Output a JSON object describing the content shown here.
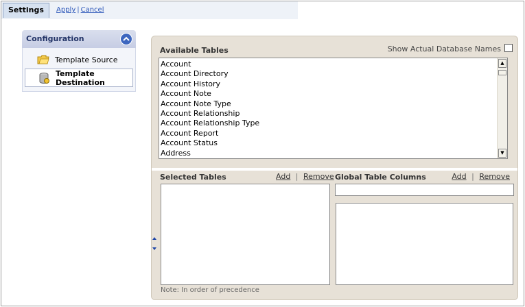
{
  "toolbar": {
    "tab_label": "Settings",
    "apply_label": "Apply",
    "separator": "|",
    "cancel_label": "Cancel"
  },
  "configuration": {
    "title": "Configuration",
    "items": [
      {
        "label": "Template Source",
        "icon": "folder-star-icon",
        "active": false
      },
      {
        "label": "Template Destination",
        "icon": "drive-icon",
        "active": true
      }
    ]
  },
  "available": {
    "title": "Available Tables",
    "show_names_label": "Show Actual Database Names",
    "show_names_checked": false,
    "tables": [
      "Account",
      "Account Directory",
      "Account History",
      "Account Note",
      "Account Note Type",
      "Account Relationship",
      "Account Relationship Type",
      "Account Report",
      "Account Status",
      "Address"
    ]
  },
  "selected": {
    "title": "Selected Tables",
    "add_label": "Add",
    "separator": "|",
    "remove_label": "Remove",
    "note": "Note: In order of precedence"
  },
  "columns": {
    "title": "Global Table Columns",
    "add_label": "Add",
    "separator": "|",
    "remove_label": "Remove",
    "input_value": ""
  },
  "colors": {
    "accent": "#3d66bf",
    "link": "#2a55b8",
    "panel_bg": "#e7e1d7"
  }
}
